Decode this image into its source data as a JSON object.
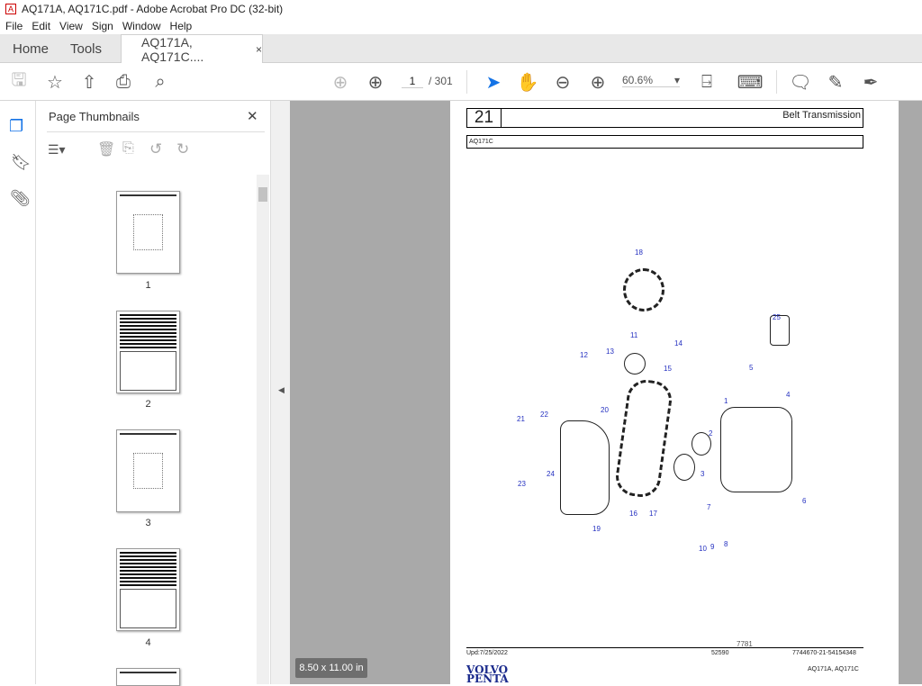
{
  "window": {
    "title": "AQ171A, AQ171C.pdf - Adobe Acrobat Pro DC (32-bit)"
  },
  "menu": [
    "File",
    "Edit",
    "View",
    "Sign",
    "Window",
    "Help"
  ],
  "tabs": {
    "home": "Home",
    "tools": "Tools",
    "document": "AQ171A, AQ171C....",
    "close": "×"
  },
  "toolbar": {
    "page_current": "1",
    "page_total": "/ 301",
    "zoom": "60.6%"
  },
  "thumbnails": {
    "title": "Page Thumbnails",
    "close": "✕",
    "pages": [
      "1",
      "2",
      "3",
      "4"
    ]
  },
  "page_size": "8.50 x 11.00 in",
  "document": {
    "section_number": "21",
    "section_title": "Belt Transmission",
    "model": "AQ171C",
    "diagram_labels": [
      "18",
      "25",
      "11",
      "12",
      "13",
      "14",
      "15",
      "5",
      "1",
      "4",
      "20",
      "21",
      "22",
      "2",
      "24",
      "23",
      "3",
      "7",
      "16",
      "17",
      "6",
      "19",
      "10",
      "9",
      "8"
    ],
    "figure_number": "7781",
    "updated": "Upd:7/25/2022",
    "code": "52590",
    "reference": "7744670-21-54154348",
    "brand_line1": "VOLVO",
    "brand_line2": "PENTA",
    "models": "AQ171A, AQ171C"
  },
  "colors": {
    "accent": "#1473e6",
    "label_blue": "#2430c0",
    "brand": "#1a2a8c"
  }
}
